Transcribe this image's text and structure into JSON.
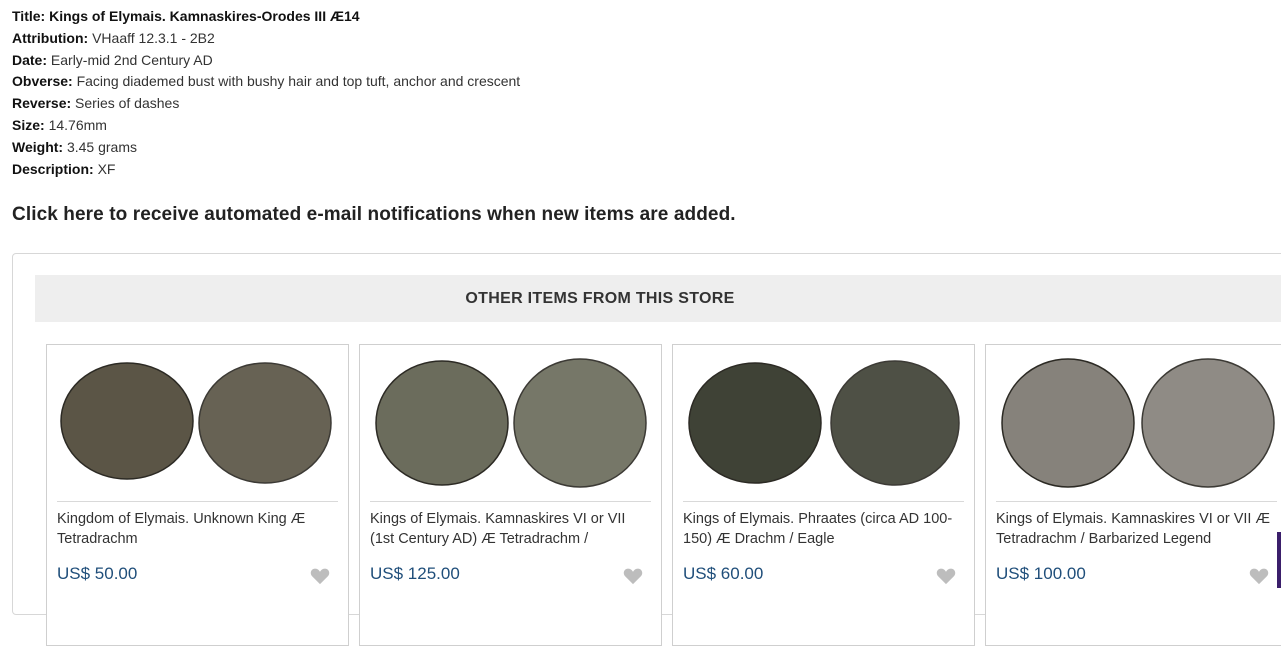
{
  "details": [
    {
      "label": "Title:",
      "value": "Kings of Elymais. Kamnaskires-Orodes III Æ14",
      "bold_value": true
    },
    {
      "label": "Attribution:",
      "value": " VHaaff 12.3.1 - 2B2"
    },
    {
      "label": "Date:",
      "value": " Early-mid 2nd Century AD"
    },
    {
      "label": "Obverse:",
      "value": " Facing diademed bust with bushy hair and top tuft, anchor and crescent"
    },
    {
      "label": "Reverse:",
      "value": " Series of dashes"
    },
    {
      "label": "Size:",
      "value": " 14.76mm"
    },
    {
      "label": "Weight:",
      "value": " 3.45 grams"
    },
    {
      "label": "Description:",
      "value": " XF"
    }
  ],
  "notify_text": "Click here to receive automated e-mail notifications when new items are added.",
  "other_items": {
    "heading": "OTHER ITEMS FROM THIS STORE",
    "items": [
      {
        "title": "Kingdom of Elymais. Unknown King Æ Tetradrachm",
        "price": "US$ 50.00",
        "coin_color": "#5b5546"
      },
      {
        "title": "Kings of Elymais. Kamnaskires VI or VII (1st Century AD) Æ Tetradrachm /",
        "price": "US$ 125.00",
        "coin_color": "#6b6c5c"
      },
      {
        "title": "Kings of Elymais. Phraates (circa AD 100-150) Æ Drachm / Eagle",
        "price": "US$ 60.00",
        "coin_color": "#3f4236"
      },
      {
        "title": "Kings of Elymais. Kamnaskires VI or VII Æ Tetradrachm / Barbarized Legend",
        "price": "US$ 100.00",
        "coin_color": "#86827b"
      }
    ]
  },
  "colors": {
    "price": "#1f4e7a",
    "heart": "#bdbdbd"
  }
}
